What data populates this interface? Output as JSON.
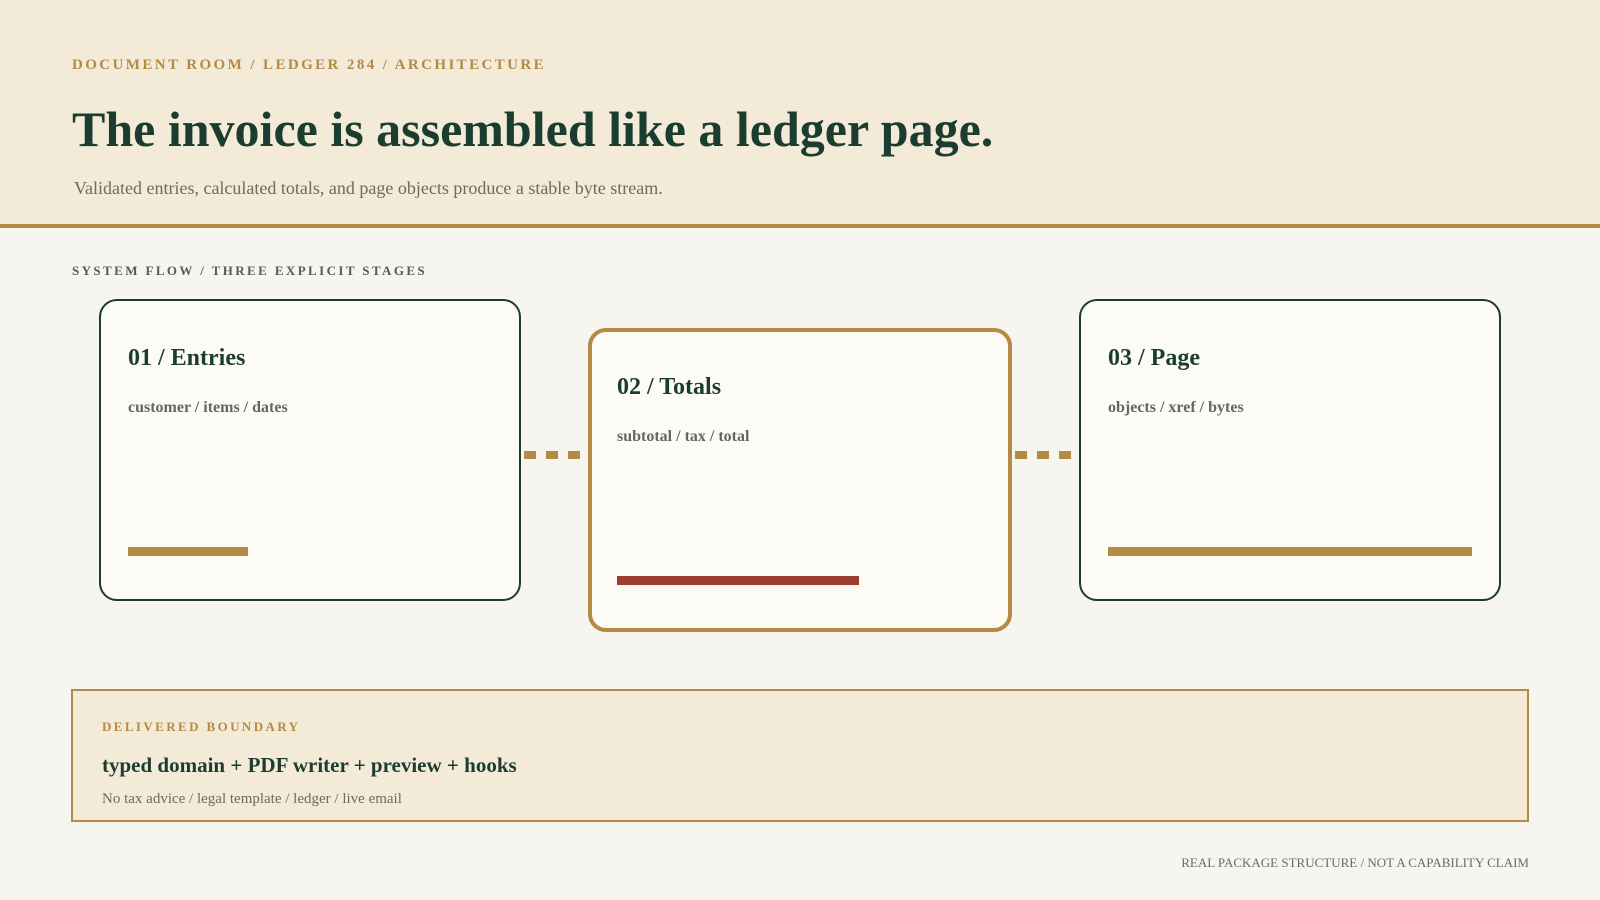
{
  "header": {
    "breadcrumb": "DOCUMENT ROOM / LEDGER 284 / ARCHITECTURE",
    "title": "The invoice is assembled like a ledger page.",
    "subtitle": "Validated entries, calculated totals, and page objects produce a stable byte stream."
  },
  "flow": {
    "label": "SYSTEM FLOW / THREE EXPLICIT STAGES",
    "stages": [
      {
        "title": "01 / Entries",
        "detail": "customer / items / dates",
        "bar_fraction": 0.33,
        "bar_color": "#b48a45",
        "highlighted": false
      },
      {
        "title": "02 / Totals",
        "detail": "subtotal / tax / total",
        "bar_fraction": 0.66,
        "bar_color": "#9b3d30",
        "highlighted": true
      },
      {
        "title": "03 / Page",
        "detail": "objects / xref / bytes",
        "bar_fraction": 1.0,
        "bar_color": "#b48a45",
        "highlighted": false
      }
    ]
  },
  "boundary": {
    "label": "DELIVERED BOUNDARY",
    "title": "typed domain + PDF writer + preview + hooks",
    "note": "No tax advice / legal template / ledger / live email"
  },
  "footer": {
    "note": "REAL PACKAGE STRUCTURE / NOT A CAPABILITY CLAIM"
  },
  "colors": {
    "ink": "#1b3d30",
    "accent": "#b48a45",
    "alert": "#9b3d30",
    "paper": "#f3ead8",
    "background": "#f7f5ef"
  }
}
